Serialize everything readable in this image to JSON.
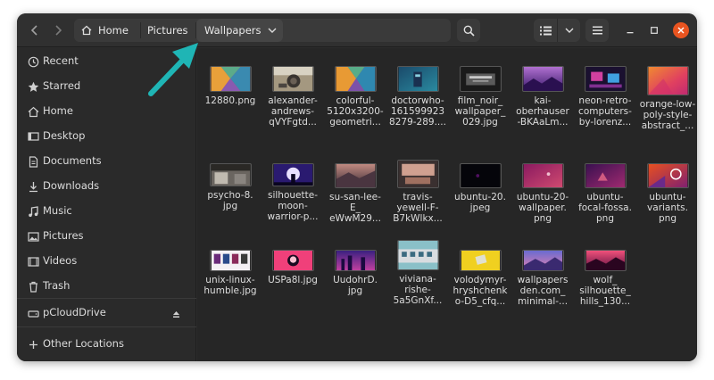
{
  "headerbar": {
    "back_icon": "chevron-left-icon",
    "forward_icon": "chevron-right-icon",
    "breadcrumbs": [
      {
        "label": "Home",
        "icon": "home-icon"
      },
      {
        "label": "Pictures"
      },
      {
        "label": "Wallpapers",
        "icon": "chevron-down-icon"
      }
    ],
    "search_icon": "search-icon",
    "view_icon": "list-view-icon",
    "view_options_icon": "chevron-down-icon",
    "menu_icon": "hamburger-menu-icon",
    "minimize_icon": "minimize-icon",
    "maximize_icon": "maximize-icon",
    "close_icon": "close-icon",
    "close_color": "#e95420"
  },
  "sidebar": {
    "items": [
      {
        "label": "Recent",
        "icon": "clock-icon"
      },
      {
        "label": "Starred",
        "icon": "star-icon"
      },
      {
        "label": "Home",
        "icon": "home-icon"
      },
      {
        "label": "Desktop",
        "icon": "desktop-icon"
      },
      {
        "label": "Documents",
        "icon": "document-icon"
      },
      {
        "label": "Downloads",
        "icon": "download-icon"
      },
      {
        "label": "Music",
        "icon": "music-icon"
      },
      {
        "label": "Pictures",
        "icon": "picture-icon"
      },
      {
        "label": "Videos",
        "icon": "video-icon"
      },
      {
        "label": "Trash",
        "icon": "trash-icon"
      },
      {
        "label": "pCloudDrive",
        "icon": "drive-icon",
        "eject_icon": "eject-icon"
      },
      {
        "label": "Other Locations",
        "icon": "plus-icon"
      }
    ]
  },
  "files": [
    {
      "name": "12880.png"
    },
    {
      "name": "alexander-\nandrews-\nqVYFgtd..."
    },
    {
      "name": "colorful-\n5120x3200-\ngeometri..."
    },
    {
      "name": "doctorwho-\n161599923\n8279-289...."
    },
    {
      "name": "film_noir_\nwallpaper_\n029.jpg"
    },
    {
      "name": "kai-\noberhauser\n-BKAaLm..."
    },
    {
      "name": "neon-retro-\ncomputers-\nby-lorenz..."
    },
    {
      "name": "orange-low-\npoly-style-\nabstract_..."
    },
    {
      "name": "psycho-8.\njpg"
    },
    {
      "name": "silhouette-\nmoon-\nwarrior-p..."
    },
    {
      "name": "su-san-lee-\nE_\neWwM29..."
    },
    {
      "name": "travis-\nyewell-F-\nB7kWlkx..."
    },
    {
      "name": "ubuntu-20.\njpeg"
    },
    {
      "name": "ubuntu-20-\nwallpaper.\npng"
    },
    {
      "name": "ubuntu-\nfocal-fossa.\npng"
    },
    {
      "name": "ubuntu-\nvariants.\npng"
    },
    {
      "name": "unix-linux-\nhumble.jpg"
    },
    {
      "name": "USPa8l.jpg"
    },
    {
      "name": "UudohrD.\njpg"
    },
    {
      "name": "viviana-\nrishe-\n5a5GnXf..."
    },
    {
      "name": "volodymyr-\nhryshchenk\no-D5_cfq..."
    },
    {
      "name": "wallpapers\nden.com_\nminimal-..."
    },
    {
      "name": "wolf_\nsilhouette_\nhills_130..."
    }
  ],
  "annotation": {
    "arrow_color": "#1fb5b5",
    "arrow_icon": "arrow-pointer-icon"
  }
}
